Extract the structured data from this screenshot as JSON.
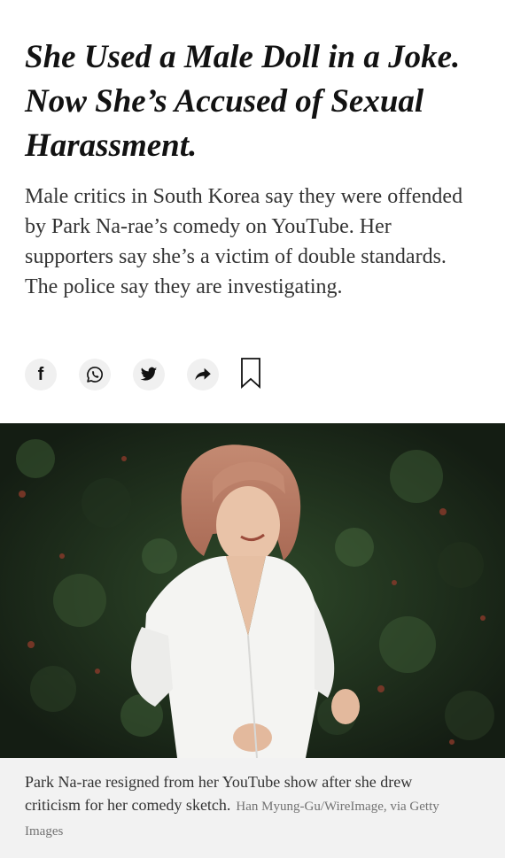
{
  "article": {
    "headline": "She Used a Male Doll in a Joke. Now She’s Accused of Sexual Harassment.",
    "summary": "Male critics in South Korea say they were offended by Park Na-rae’s comedy on YouTube. Her supporters say she’s a victim of double standards. The police say they are investigating."
  },
  "share": {
    "buttons": [
      {
        "icon": "facebook-icon",
        "glyph": "f"
      },
      {
        "icon": "whatsapp-icon"
      },
      {
        "icon": "twitter-icon"
      },
      {
        "icon": "share-arrow-icon"
      }
    ],
    "bookmark_icon": "bookmark-icon"
  },
  "photo": {
    "caption": "Park Na-rae resigned from her YouTube show after she drew criticism for her comedy sketch.",
    "credit": "Han Myung-Gu/WireImage, via Getty Images"
  },
  "colors": {
    "text": "#121212",
    "summary_text": "#333333",
    "caption_bg": "#f2f2f2",
    "credit_text": "#727272",
    "share_bg": "#f0f0f0"
  }
}
